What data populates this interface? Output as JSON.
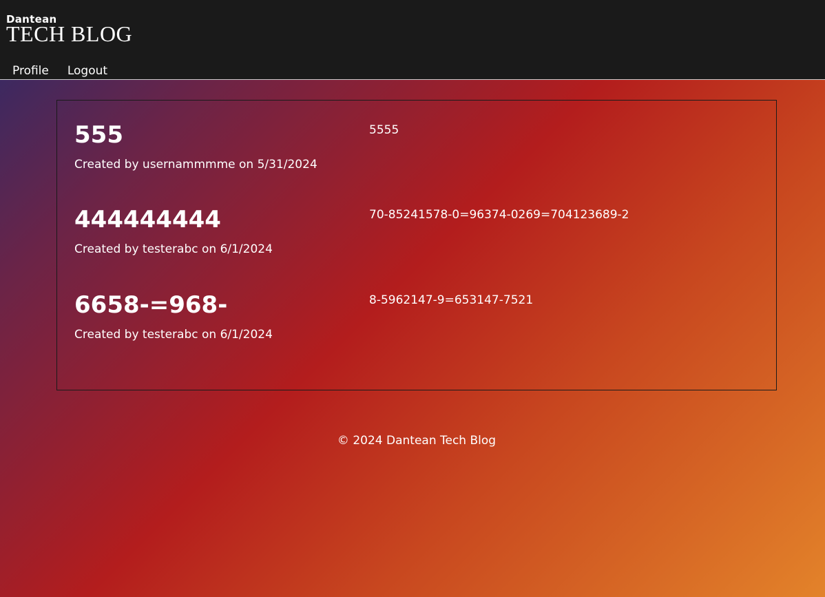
{
  "header": {
    "logo_small": "Dantean",
    "logo_big": "TECH BLOG",
    "nav": [
      {
        "label": "Profile"
      },
      {
        "label": "Logout"
      }
    ]
  },
  "posts": [
    {
      "title": "555",
      "meta": "Created by usernammmme on 5/31/2024",
      "body": "5555"
    },
    {
      "title": "444444444",
      "meta": "Created by testerabc on 6/1/2024",
      "body": "70-85241578-0=96374-0269=704123689-2"
    },
    {
      "title": "6658-=968-",
      "meta": "Created by testerabc on 6/1/2024",
      "body": "8-5962147-9=653147-7521"
    }
  ],
  "footer": {
    "text": "© 2024 Dantean Tech Blog"
  },
  "colors": {
    "header_bg": "#1a1a1a",
    "gradient_start": "#2b2b6a",
    "gradient_mid": "#b31d1d",
    "gradient_end": "#e3832a",
    "text": "#ffffff"
  }
}
